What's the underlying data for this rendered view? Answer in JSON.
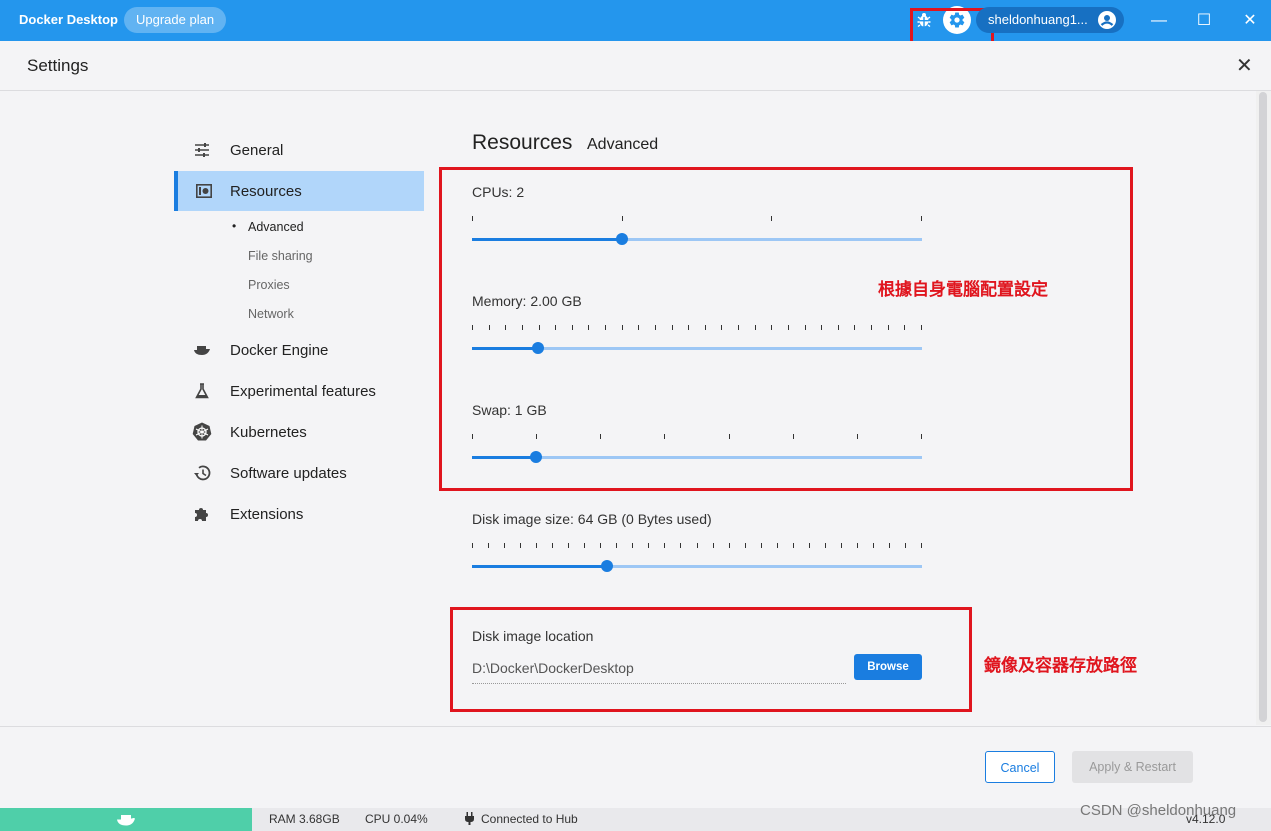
{
  "titlebar": {
    "app_name": "Docker Desktop",
    "upgrade_label": "Upgrade plan",
    "username": "sheldonhuang1...",
    "minimize": "—",
    "maximize": "☐",
    "close": "✕",
    "accent": "#2496ed"
  },
  "settings": {
    "title": "Settings",
    "close": "✕"
  },
  "sidebar": {
    "items": [
      {
        "label": "General",
        "icon": "sliders-icon"
      },
      {
        "label": "Resources",
        "icon": "resources-icon",
        "active": true
      },
      {
        "label": "Docker Engine",
        "icon": "whale-engine-icon"
      },
      {
        "label": "Experimental features",
        "icon": "flask-icon"
      },
      {
        "label": "Kubernetes",
        "icon": "helm-wheel-icon"
      },
      {
        "label": "Software updates",
        "icon": "history-icon"
      },
      {
        "label": "Extensions",
        "icon": "puzzle-icon"
      }
    ],
    "sub_items": [
      "Advanced",
      "File sharing",
      "Proxies",
      "Network"
    ]
  },
  "tabs": {
    "main": "Resources",
    "sub": "Advanced"
  },
  "resources": {
    "cpus": {
      "label": "CPUs: 2",
      "fraction": 0.333
    },
    "memory": {
      "label": "Memory: 2.00 GB",
      "fraction": 0.146
    },
    "swap": {
      "label": "Swap: 1 GB",
      "fraction": 0.142
    },
    "disk": {
      "label": "Disk image size: 64 GB (0 Bytes used)",
      "fraction": 0.3
    },
    "disk_location_label": "Disk image location",
    "disk_location_value": "D:\\Docker\\DockerDesktop",
    "browse_label": "Browse"
  },
  "annotations": {
    "resources_note": "根據自身電腦配置設定",
    "disk_note": "鏡像及容器存放路徑"
  },
  "footer": {
    "cancel": "Cancel",
    "apply": "Apply & Restart"
  },
  "statusbar": {
    "ram": "RAM 3.68GB",
    "cpu": "CPU 0.04%",
    "hub": "Connected to Hub",
    "version": "v4.12.0",
    "watermark": "CSDN @sheldonhuang"
  }
}
